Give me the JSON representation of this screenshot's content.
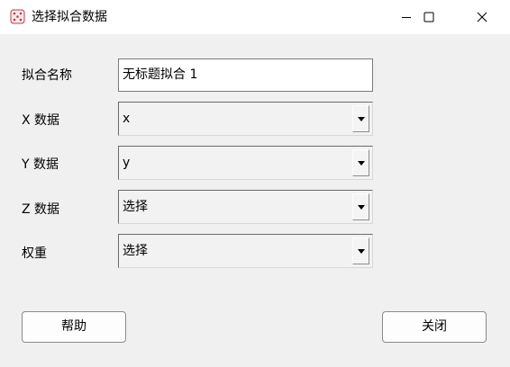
{
  "window": {
    "title": "选择拟合数据",
    "icon": "dice-icon",
    "controls": [
      "minimize-icon",
      "maximize-icon",
      "close-icon"
    ]
  },
  "form": {
    "name": {
      "label": "拟合名称",
      "value": "无标题拟合 1"
    },
    "x_data": {
      "label": "X 数据",
      "selected": "x"
    },
    "y_data": {
      "label": "Y 数据",
      "selected": "y"
    },
    "z_data": {
      "label": "Z 数据",
      "selected": "选择"
    },
    "weights": {
      "label": "权重",
      "selected": "选择"
    }
  },
  "buttons": {
    "help": "帮助",
    "close": "关闭"
  }
}
